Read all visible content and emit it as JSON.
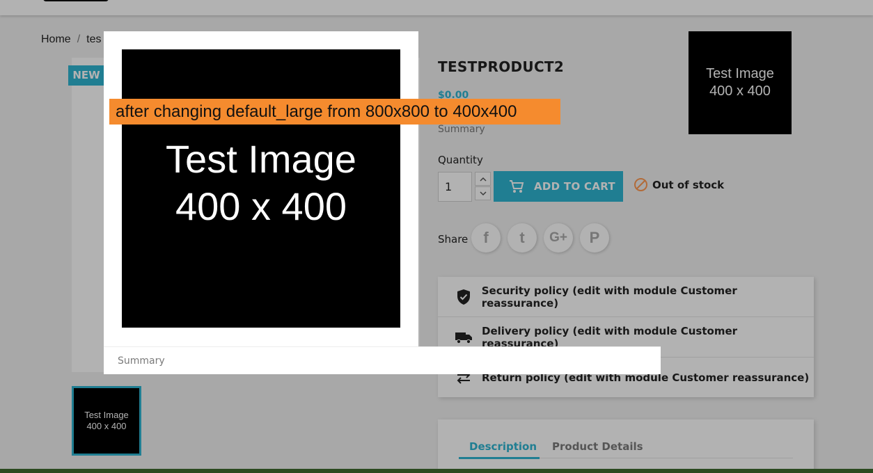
{
  "breadcrumb": {
    "home": "Home",
    "separator": "/",
    "current": "tes"
  },
  "badge": {
    "new": "NEW"
  },
  "thumbnail": {
    "line1": "Test Image",
    "line2": "400 x 400"
  },
  "product": {
    "title": "TESTPRODUCT2",
    "price": "$0.00",
    "summary": "Summary",
    "corner_image": {
      "line1": "Test Image",
      "line2": "400 x 400"
    }
  },
  "quantity": {
    "label": "Quantity",
    "value": "1"
  },
  "cart": {
    "add_label": "ADD TO CART",
    "stock_status": "Out of stock"
  },
  "share": {
    "label": "Share",
    "networks": [
      {
        "name": "facebook",
        "glyph": "f"
      },
      {
        "name": "twitter",
        "glyph": "t"
      },
      {
        "name": "google-plus",
        "glyph": "G+"
      },
      {
        "name": "pinterest",
        "glyph": "P"
      }
    ]
  },
  "reassurance": {
    "items": [
      {
        "icon": "shield-icon",
        "text": "Security policy (edit with module Customer reassurance)"
      },
      {
        "icon": "truck-icon",
        "text": "Delivery policy (edit with module Customer reassurance)"
      },
      {
        "icon": "swap-arrows-icon",
        "text": "Return policy (edit with module Customer reassurance)"
      }
    ]
  },
  "tabs": {
    "description": "Description",
    "details": "Product Details"
  },
  "modal": {
    "image": {
      "line1": "Test Image",
      "line2": "400 x 400"
    },
    "caption": "Summary"
  },
  "annotation": {
    "text": "after changing default_large from 800x800 to 400x400"
  },
  "colors": {
    "accent": "#2fb5d2",
    "annotation": "#f58b2e",
    "out_of_stock": "#ff9a52"
  }
}
